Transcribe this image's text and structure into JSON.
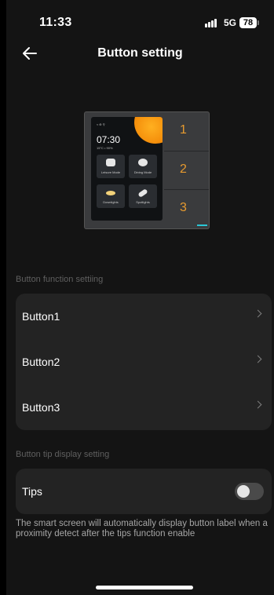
{
  "status_bar": {
    "time": "11:33",
    "network": "5G",
    "battery": "78"
  },
  "header": {
    "title": "Button setting"
  },
  "device": {
    "clock": "07:30",
    "weather_info": "15°C  • 90%",
    "status_icons": "≈ ⊕ ⚲",
    "scenes": [
      "Leisure Mode",
      "Dining Mode",
      "Downlights",
      "Spotlights"
    ],
    "keys": [
      "1",
      "2",
      "3"
    ]
  },
  "function_section": {
    "title": "Button function settiing",
    "buttons": [
      "Button1",
      "Button2",
      "Button3"
    ]
  },
  "tip_section": {
    "title": "Button tip display setting",
    "label": "Tips",
    "enabled": false,
    "note": "The smart screen will automatically display button label when a proximity detect after the tips function enable"
  }
}
